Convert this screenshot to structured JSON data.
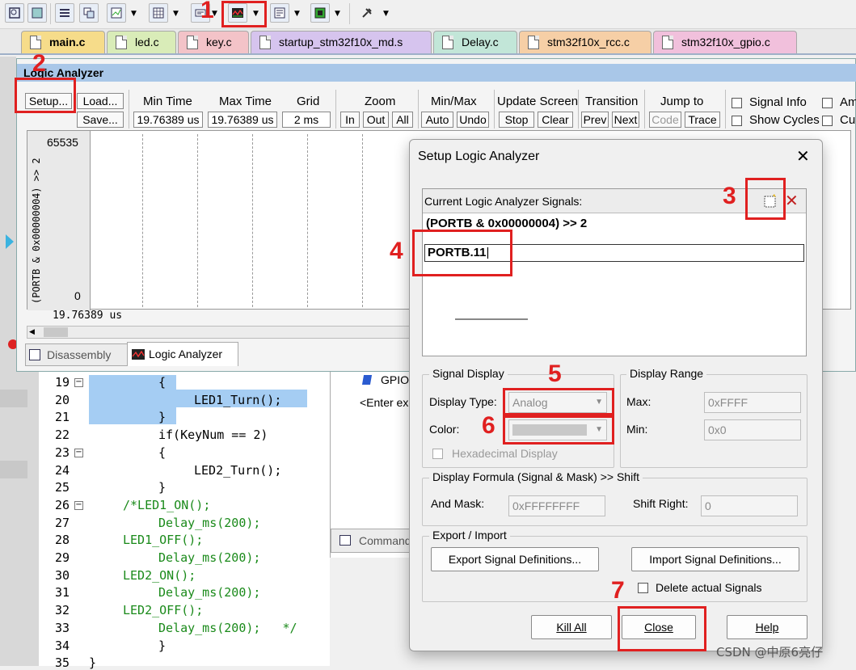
{
  "tabs": [
    {
      "label": "main.c",
      "color": "#f6dc8a"
    },
    {
      "label": "led.c",
      "color": "#d9ecb8"
    },
    {
      "label": "key.c",
      "color": "#f3c3c8"
    },
    {
      "label": "startup_stm32f10x_md.s",
      "color": "#d6c4ee"
    },
    {
      "label": "Delay.c",
      "color": "#c2e6d8"
    },
    {
      "label": "stm32f10x_rcc.c",
      "color": "#f6cfa6"
    },
    {
      "label": "stm32f10x_gpio.c",
      "color": "#f1c0dc"
    }
  ],
  "la": {
    "title": "Logic Analyzer",
    "setup": "Setup...",
    "load": "Load...",
    "save": "Save...",
    "min_time_label": "Min Time",
    "min_time": "19.76389 us",
    "max_time_label": "Max Time",
    "max_time": "19.76389 us",
    "grid_label": "Grid",
    "grid": "2 ms",
    "zoom_label": "Zoom",
    "zoom_in": "In",
    "zoom_out": "Out",
    "zoom_all": "All",
    "minmax_label": "Min/Max",
    "auto": "Auto",
    "undo": "Undo",
    "update_label": "Update Screen",
    "stop": "Stop",
    "clear": "Clear",
    "transition_label": "Transition",
    "prev": "Prev",
    "next": "Next",
    "jump_label": "Jump to",
    "code": "Code",
    "trace": "Trace",
    "signal_info": "Signal Info",
    "show_cycles": "Show Cycles",
    "amp": "Am",
    "cur": "Cu",
    "y_max": "65535",
    "y_min": "0",
    "signal_name": "(PORTB & 0x00000004) >> 2",
    "cursor_time": "19.76389 us"
  },
  "bottom_tabs": {
    "disassembly": "Disassembly",
    "logic_analyzer": "Logic Analyzer"
  },
  "code_lines": [
    {
      "n": "19",
      "text": "{"
    },
    {
      "n": "20",
      "text": "LED1_Turn();"
    },
    {
      "n": "21",
      "text": "}"
    },
    {
      "n": "22",
      "text": "if(KeyNum == 2)"
    },
    {
      "n": "23",
      "text": "{"
    },
    {
      "n": "24",
      "text": "LED2_Turn();"
    },
    {
      "n": "25",
      "text": "}"
    },
    {
      "n": "26",
      "text": "/*LED1_ON();"
    },
    {
      "n": "27",
      "text": "Delay_ms(200);"
    },
    {
      "n": "28",
      "text": "LED1_OFF();"
    },
    {
      "n": "29",
      "text": "Delay_ms(200);"
    },
    {
      "n": "30",
      "text": "LED2_ON();"
    },
    {
      "n": "31",
      "text": "Delay_ms(200);"
    },
    {
      "n": "32",
      "text": "LED2_OFF();"
    },
    {
      "n": "33",
      "text": "Delay_ms(200);   */"
    },
    {
      "n": "34",
      "text": "}"
    },
    {
      "n": "35",
      "text": "}"
    }
  ],
  "mid_panel": {
    "gpio": "GPIO",
    "enter": "<Enter ex",
    "command": "Command"
  },
  "dialog": {
    "title": "Setup Logic Analyzer",
    "signals_label": "Current Logic Analyzer Signals:",
    "signal_1": "(PORTB & 0x00000004) >> 2",
    "signal_2": "PORTB.11",
    "signal_display_label": "Signal Display",
    "display_type_label": "Display Type:",
    "display_type": "Analog",
    "color_label": "Color:",
    "hexadecimal": "Hexadecimal Display",
    "display_range_label": "Display Range",
    "max_label": "Max:",
    "max_value": "0xFFFF",
    "min_label": "Min:",
    "min_value": "0x0",
    "formula_label": "Display Formula (Signal & Mask) >> Shift",
    "and_mask_label": "And Mask:",
    "and_mask": "0xFFFFFFFF",
    "shift_right_label": "Shift Right:",
    "shift_right": "0",
    "export_import_label": "Export / Import",
    "export_btn": "Export Signal Definitions...",
    "import_btn": "Import Signal Definitions...",
    "delete_actual": "Delete actual Signals",
    "kill_all": "Kill All",
    "close": "Close",
    "help": "Help"
  },
  "annotations": [
    "1",
    "2",
    "3",
    "4",
    "5",
    "6",
    "7"
  ],
  "watermark": "CSDN @中原6亮仔",
  "colors": {
    "annotation_red": "#e02020",
    "title_blue": "#a9c7e8",
    "code_highlight": "#a5cdf3"
  }
}
